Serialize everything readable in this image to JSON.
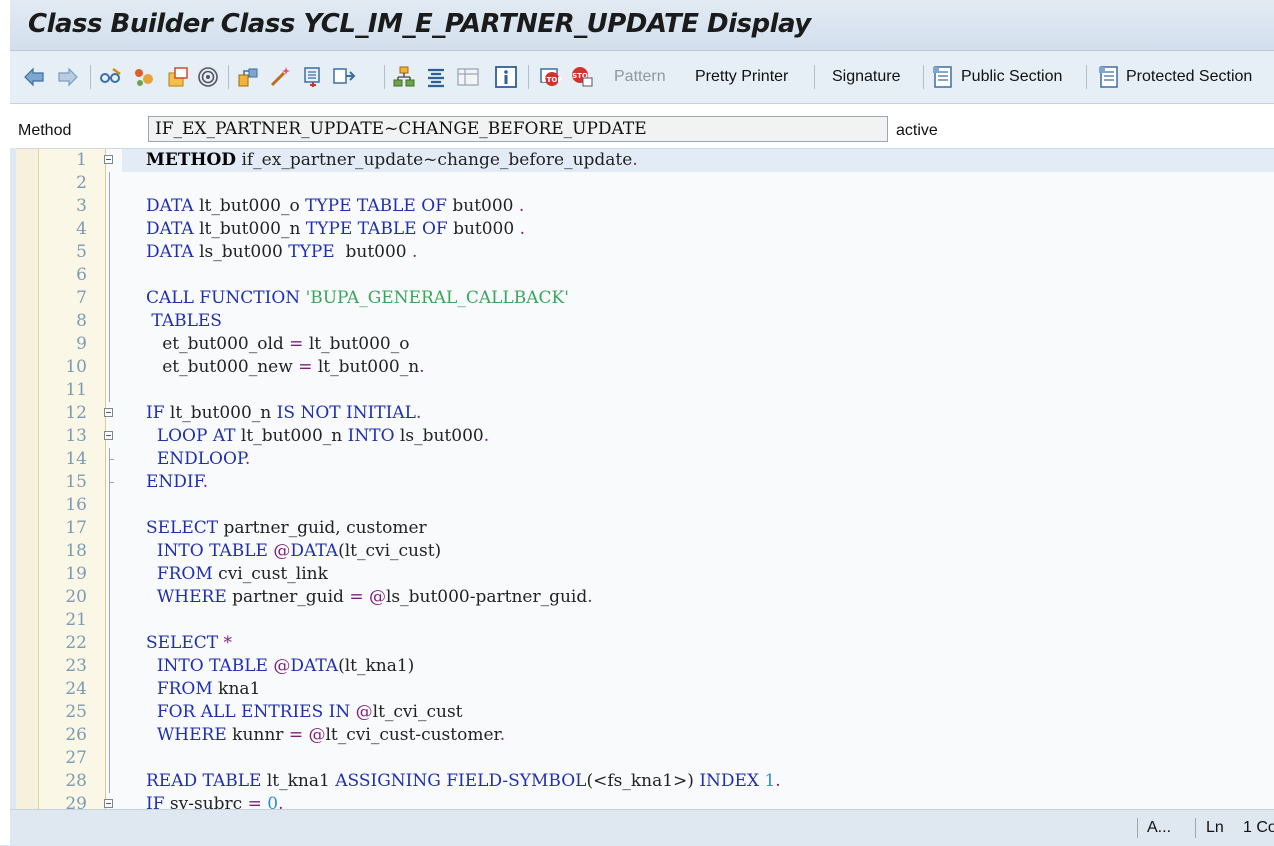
{
  "window": {
    "title": "Class Builder Class YCL_IM_E_PARTNER_UPDATE Display"
  },
  "toolbar": {
    "icons": [
      "back-arrow-icon",
      "forward-arrow-icon",
      "other-object-icon",
      "display-change-icon",
      "active-inactive-icon",
      "check-icon",
      "activate-icon",
      "test-icon",
      "where-used-icon",
      "object-list-icon",
      "hierarchy-icon",
      "navigation-window-icon",
      "display-object-list-icon",
      "info-icon",
      "breakpoint-icon",
      "external-breakpoint-icon"
    ],
    "pattern_label": "Pattern",
    "pretty_printer_label": "Pretty Printer",
    "signature_label": "Signature",
    "public_section_label": "Public Section",
    "protected_section_label": "Protected Section"
  },
  "method": {
    "label": "Method",
    "value": "IF_EX_PARTNER_UPDATE~CHANGE_BEFORE_UPDATE",
    "status": "active"
  },
  "editor": {
    "lines": [
      {
        "n": "1",
        "fold": "open",
        "code": "METHOD if_ex_partner_update~change_before_update."
      },
      {
        "n": "2",
        "fold": "line",
        "code": ""
      },
      {
        "n": "3",
        "fold": "line",
        "code": "DATA lt_but000_o TYPE TABLE OF but000 ."
      },
      {
        "n": "4",
        "fold": "line",
        "code": "DATA lt_but000_n TYPE TABLE OF but000 ."
      },
      {
        "n": "5",
        "fold": "line",
        "code": "DATA ls_but000 TYPE  but000 ."
      },
      {
        "n": "6",
        "fold": "line",
        "code": ""
      },
      {
        "n": "7",
        "fold": "line",
        "code": "CALL FUNCTION 'BUPA_GENERAL_CALLBACK'"
      },
      {
        "n": "8",
        "fold": "line",
        "code": " TABLES"
      },
      {
        "n": "9",
        "fold": "line",
        "code": "   et_but000_old = lt_but000_o"
      },
      {
        "n": "10",
        "fold": "line",
        "code": "   et_but000_new = lt_but000_n."
      },
      {
        "n": "11",
        "fold": "line",
        "code": ""
      },
      {
        "n": "12",
        "fold": "open",
        "code": "IF lt_but000_n IS NOT INITIAL."
      },
      {
        "n": "13",
        "fold": "open",
        "code": "  LOOP AT lt_but000_n INTO ls_but000."
      },
      {
        "n": "14",
        "fold": "end",
        "code": "  ENDLOOP."
      },
      {
        "n": "15",
        "fold": "end",
        "code": "ENDIF."
      },
      {
        "n": "16",
        "fold": "line",
        "code": ""
      },
      {
        "n": "17",
        "fold": "line",
        "code": "SELECT partner_guid, customer"
      },
      {
        "n": "18",
        "fold": "line",
        "code": "  INTO TABLE @DATA(lt_cvi_cust)"
      },
      {
        "n": "19",
        "fold": "line",
        "code": "  FROM cvi_cust_link"
      },
      {
        "n": "20",
        "fold": "line",
        "code": "  WHERE partner_guid = @ls_but000-partner_guid."
      },
      {
        "n": "21",
        "fold": "line",
        "code": ""
      },
      {
        "n": "22",
        "fold": "line",
        "code": "SELECT *"
      },
      {
        "n": "23",
        "fold": "line",
        "code": "  INTO TABLE @DATA(lt_kna1)"
      },
      {
        "n": "24",
        "fold": "line",
        "code": "  FROM kna1"
      },
      {
        "n": "25",
        "fold": "line",
        "code": "  FOR ALL ENTRIES IN @lt_cvi_cust"
      },
      {
        "n": "26",
        "fold": "line",
        "code": "  WHERE kunnr = @lt_cvi_cust-customer."
      },
      {
        "n": "27",
        "fold": "line",
        "code": ""
      },
      {
        "n": "28",
        "fold": "line",
        "code": "READ TABLE lt_kna1 ASSIGNING FIELD-SYMBOL(<fs_kna1>) INDEX 1."
      },
      {
        "n": "29",
        "fold": "open",
        "code": "IF sy-subrc = 0."
      }
    ]
  },
  "status_bar": {
    "mode": "A...",
    "ln_label": "Ln",
    "col_value": "1 Co"
  },
  "colors": {
    "keyword": "#1f2fb0",
    "string": "#3aa55a",
    "number": "#2c8fd6",
    "line_number": "#7a9bb3"
  }
}
